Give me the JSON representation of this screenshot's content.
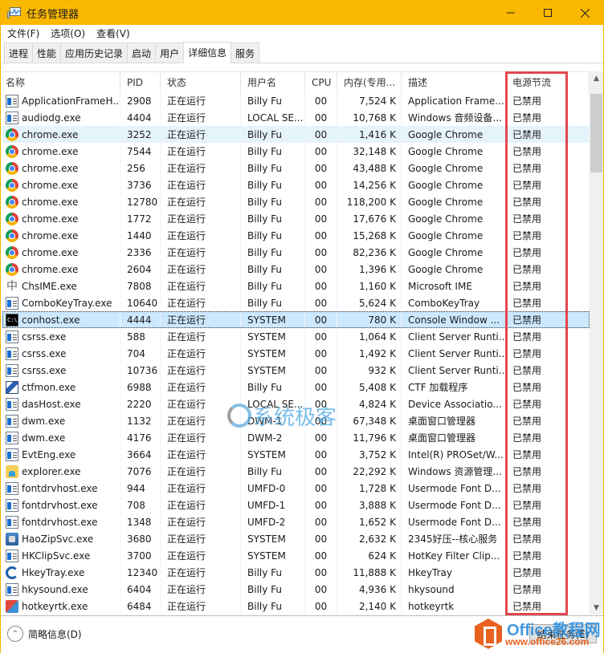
{
  "window": {
    "title": "任务管理器",
    "controls": {
      "minimize": "—",
      "maximize": "☐",
      "close": "✕"
    }
  },
  "menu": [
    "文件(F)",
    "选项(O)",
    "查看(V)"
  ],
  "tabs": [
    {
      "label": "进程",
      "active": false
    },
    {
      "label": "性能",
      "active": false
    },
    {
      "label": "应用历史记录",
      "active": false
    },
    {
      "label": "启动",
      "active": false
    },
    {
      "label": "用户",
      "active": false
    },
    {
      "label": "详细信息",
      "active": true
    },
    {
      "label": "服务",
      "active": false
    }
  ],
  "columns": {
    "name": "名称",
    "pid": "PID",
    "status": "状态",
    "user": "用户名",
    "cpu": "CPU",
    "mem": "内存(专用...",
    "desc": "描述",
    "power": "电源节流"
  },
  "sort_indicator": "^",
  "highlight_color": "#e2474f",
  "rows": [
    {
      "icon": "generic",
      "name": "ApplicationFrameH...",
      "pid": "2908",
      "status": "正在运行",
      "user": "Billy Fu",
      "cpu": "00",
      "mem": "7,524 K",
      "desc": "Application Frame...",
      "power": "已禁用"
    },
    {
      "icon": "generic",
      "name": "audiodg.exe",
      "pid": "4404",
      "status": "正在运行",
      "user": "LOCAL SE...",
      "cpu": "00",
      "mem": "10,768 K",
      "desc": "Windows 音频设备...",
      "power": "已禁用"
    },
    {
      "icon": "chrome",
      "name": "chrome.exe",
      "pid": "3252",
      "status": "正在运行",
      "user": "Billy Fu",
      "cpu": "00",
      "mem": "1,416 K",
      "desc": "Google Chrome",
      "power": "已禁用",
      "state": "hover"
    },
    {
      "icon": "chrome",
      "name": "chrome.exe",
      "pid": "7544",
      "status": "正在运行",
      "user": "Billy Fu",
      "cpu": "00",
      "mem": "32,148 K",
      "desc": "Google Chrome",
      "power": "已禁用"
    },
    {
      "icon": "chrome",
      "name": "chrome.exe",
      "pid": "256",
      "status": "正在运行",
      "user": "Billy Fu",
      "cpu": "00",
      "mem": "43,488 K",
      "desc": "Google Chrome",
      "power": "已禁用"
    },
    {
      "icon": "chrome",
      "name": "chrome.exe",
      "pid": "3736",
      "status": "正在运行",
      "user": "Billy Fu",
      "cpu": "00",
      "mem": "14,256 K",
      "desc": "Google Chrome",
      "power": "已禁用"
    },
    {
      "icon": "chrome",
      "name": "chrome.exe",
      "pid": "12780",
      "status": "正在运行",
      "user": "Billy Fu",
      "cpu": "00",
      "mem": "118,200 K",
      "desc": "Google Chrome",
      "power": "已禁用"
    },
    {
      "icon": "chrome",
      "name": "chrome.exe",
      "pid": "1772",
      "status": "正在运行",
      "user": "Billy Fu",
      "cpu": "00",
      "mem": "17,676 K",
      "desc": "Google Chrome",
      "power": "已禁用"
    },
    {
      "icon": "chrome",
      "name": "chrome.exe",
      "pid": "1440",
      "status": "正在运行",
      "user": "Billy Fu",
      "cpu": "00",
      "mem": "15,268 K",
      "desc": "Google Chrome",
      "power": "已禁用"
    },
    {
      "icon": "chrome",
      "name": "chrome.exe",
      "pid": "2336",
      "status": "正在运行",
      "user": "Billy Fu",
      "cpu": "00",
      "mem": "82,236 K",
      "desc": "Google Chrome",
      "power": "已禁用"
    },
    {
      "icon": "chrome",
      "name": "chrome.exe",
      "pid": "2604",
      "status": "正在运行",
      "user": "Billy Fu",
      "cpu": "00",
      "mem": "1,396 K",
      "desc": "Google Chrome",
      "power": "已禁用"
    },
    {
      "icon": "ime",
      "name": "ChsIME.exe",
      "pid": "7808",
      "status": "正在运行",
      "user": "Billy Fu",
      "cpu": "00",
      "mem": "1,160 K",
      "desc": "Microsoft IME",
      "power": "已禁用"
    },
    {
      "icon": "generic",
      "name": "ComboKeyTray.exe",
      "pid": "10640",
      "status": "正在运行",
      "user": "Billy Fu",
      "cpu": "00",
      "mem": "5,624 K",
      "desc": "ComboKeyTray",
      "power": "已禁用"
    },
    {
      "icon": "console",
      "name": "conhost.exe",
      "pid": "4444",
      "status": "正在运行",
      "user": "SYSTEM",
      "cpu": "00",
      "mem": "780 K",
      "desc": "Console Window ...",
      "power": "已禁用",
      "state": "selected"
    },
    {
      "icon": "generic",
      "name": "csrss.exe",
      "pid": "588",
      "status": "正在运行",
      "user": "SYSTEM",
      "cpu": "00",
      "mem": "1,064 K",
      "desc": "Client Server Runti...",
      "power": "已禁用"
    },
    {
      "icon": "generic",
      "name": "csrss.exe",
      "pid": "704",
      "status": "正在运行",
      "user": "SYSTEM",
      "cpu": "00",
      "mem": "1,492 K",
      "desc": "Client Server Runti...",
      "power": "已禁用"
    },
    {
      "icon": "generic",
      "name": "csrss.exe",
      "pid": "10736",
      "status": "正在运行",
      "user": "SYSTEM",
      "cpu": "00",
      "mem": "932 K",
      "desc": "Client Server Runti...",
      "power": "已禁用"
    },
    {
      "icon": "ctf",
      "name": "ctfmon.exe",
      "pid": "6988",
      "status": "正在运行",
      "user": "Billy Fu",
      "cpu": "00",
      "mem": "5,408 K",
      "desc": "CTF 加载程序",
      "power": "已禁用"
    },
    {
      "icon": "generic",
      "name": "dasHost.exe",
      "pid": "2220",
      "status": "正在运行",
      "user": "LOCAL SE...",
      "cpu": "00",
      "mem": "4,824 K",
      "desc": "Device Associatio...",
      "power": "已禁用"
    },
    {
      "icon": "generic",
      "name": "dwm.exe",
      "pid": "1132",
      "status": "正在运行",
      "user": "DWM-1",
      "cpu": "00",
      "mem": "67,348 K",
      "desc": "桌面窗口管理器",
      "power": "已禁用"
    },
    {
      "icon": "generic",
      "name": "dwm.exe",
      "pid": "4176",
      "status": "正在运行",
      "user": "DWM-2",
      "cpu": "00",
      "mem": "11,796 K",
      "desc": "桌面窗口管理器",
      "power": "已禁用"
    },
    {
      "icon": "generic",
      "name": "EvtEng.exe",
      "pid": "3664",
      "status": "正在运行",
      "user": "SYSTEM",
      "cpu": "00",
      "mem": "3,752 K",
      "desc": "Intel(R) PROSet/W...",
      "power": "已禁用"
    },
    {
      "icon": "folder",
      "name": "explorer.exe",
      "pid": "7076",
      "status": "正在运行",
      "user": "Billy Fu",
      "cpu": "00",
      "mem": "22,292 K",
      "desc": "Windows 资源管理...",
      "power": "已禁用"
    },
    {
      "icon": "generic",
      "name": "fontdrvhost.exe",
      "pid": "944",
      "status": "正在运行",
      "user": "UMFD-0",
      "cpu": "00",
      "mem": "1,728 K",
      "desc": "Usermode Font D...",
      "power": "已禁用"
    },
    {
      "icon": "generic",
      "name": "fontdrvhost.exe",
      "pid": "708",
      "status": "正在运行",
      "user": "UMFD-1",
      "cpu": "00",
      "mem": "3,888 K",
      "desc": "Usermode Font D...",
      "power": "已禁用"
    },
    {
      "icon": "generic",
      "name": "fontdrvhost.exe",
      "pid": "1348",
      "status": "正在运行",
      "user": "UMFD-2",
      "cpu": "00",
      "mem": "1,652 K",
      "desc": "Usermode Font D...",
      "power": "已禁用"
    },
    {
      "icon": "haozip",
      "name": "HaoZipSvc.exe",
      "pid": "3680",
      "status": "正在运行",
      "user": "SYSTEM",
      "cpu": "00",
      "mem": "2,632 K",
      "desc": "2345好压--核心服务",
      "power": "已禁用"
    },
    {
      "icon": "generic",
      "name": "HKClipSvc.exe",
      "pid": "3700",
      "status": "正在运行",
      "user": "SYSTEM",
      "cpu": "00",
      "mem": "624 K",
      "desc": "HotKey Filter Clip...",
      "power": "已禁用"
    },
    {
      "icon": "hkey",
      "name": "HkeyTray.exe",
      "pid": "12340",
      "status": "正在运行",
      "user": "Billy Fu",
      "cpu": "00",
      "mem": "11,888 K",
      "desc": "HkeyTray",
      "power": "已禁用"
    },
    {
      "icon": "generic",
      "name": "hkysound.exe",
      "pid": "6404",
      "status": "正在运行",
      "user": "Billy Fu",
      "cpu": "00",
      "mem": "4,936 K",
      "desc": "hkysound",
      "power": "已禁用"
    },
    {
      "icon": "hotkey",
      "name": "hotkeyrtk.exe",
      "pid": "6484",
      "status": "正在运行",
      "user": "Billy Fu",
      "cpu": "00",
      "mem": "2,140 K",
      "desc": "hotkeyrtk",
      "power": "已禁用"
    }
  ],
  "footer": {
    "collapse_label": "简略信息(D)",
    "end_task_label": "结束任务(E)"
  },
  "watermarks": {
    "center": "系统极客",
    "corner_title": "Office教程网",
    "corner_url": "www.office26.com"
  }
}
